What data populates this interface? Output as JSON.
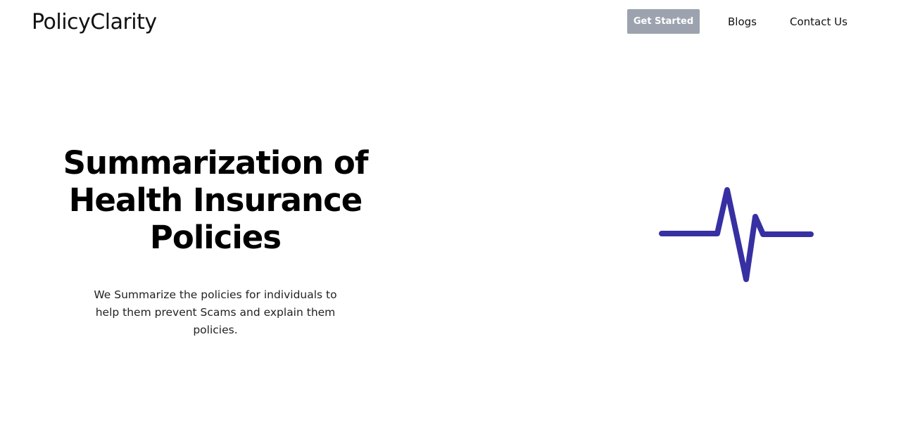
{
  "header": {
    "logo": "PolicyClarity",
    "nav": {
      "get_started": "Get Started",
      "blogs": "Blogs",
      "contact": "Contact Us"
    }
  },
  "hero": {
    "title": "Summarization of Health Insurance Policies",
    "subtitle": "We Summarize the policies for individuals to help them prevent Scams and explain them policies."
  },
  "illustration": {
    "icon": "heartbeat-pulse-icon",
    "color": "#3730a3"
  },
  "colors": {
    "button_bg": "#9ca3af",
    "text": "#111111"
  }
}
